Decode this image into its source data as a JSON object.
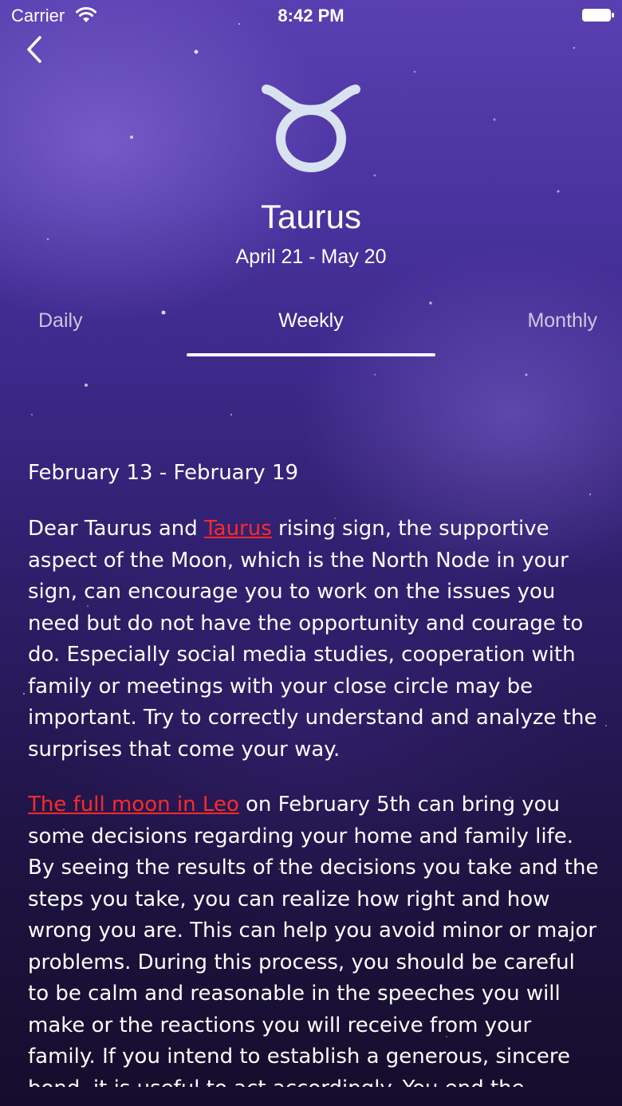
{
  "status_bar": {
    "carrier": "Carrier",
    "time": "8:42 PM"
  },
  "header": {
    "sign_icon": "taurus-glyph-icon",
    "sign_name": "Taurus",
    "sign_dates": "April 21 - May 20"
  },
  "tabs": [
    {
      "label": "Daily",
      "selected": false
    },
    {
      "label": "Weekly",
      "selected": true
    },
    {
      "label": "Monthly",
      "selected": false
    }
  ],
  "content": {
    "range": "February 13 - February 19",
    "p1": {
      "before": "Dear Taurus and ",
      "link": "Taurus",
      "after": " rising sign, the supportive aspect of the Moon, which is the North Node in your sign, can encourage you to work on the issues you need but do not have the opportunity and courage to do. Especially social media studies, cooperation with family or meetings with your close circle may be important. Try to correctly understand and analyze the surprises that come your way."
    },
    "p2": {
      "link": "The full moon in Leo",
      "after": " on February 5th can bring you some decisions regarding your home and family life. By seeing the results of the decisions you take and the steps you take, you can realize how right and how wrong you are. This can help you avoid minor or major problems. During this process, you should be careful to be calm and reasonable in the speeches you will make or the reactions you will receive from your family. If you intend to establish a generous, sincere bond, it is useful to act accordingly. You end the problems with moving and"
    }
  },
  "colors": {
    "link": "#ff2a2a",
    "icon": "#d8e2f0",
    "text": "#ffffff"
  }
}
